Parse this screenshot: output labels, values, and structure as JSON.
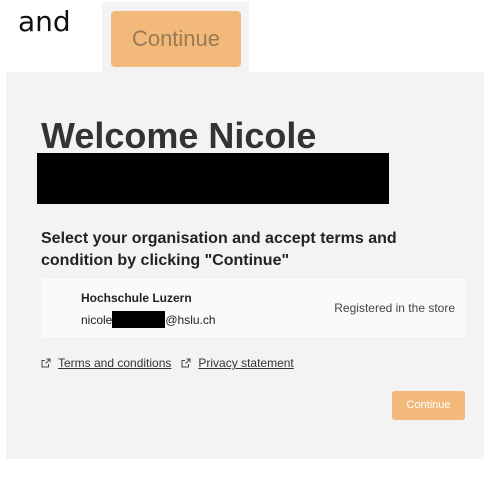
{
  "header": {
    "word": "and",
    "continue_preview_label": "Continue"
  },
  "page": {
    "title": "Welcome Nicole",
    "instruction": "Select your organisation and accept terms and condition by clicking \"Continue\""
  },
  "organisation": {
    "name": "Hochschule Luzern",
    "email_prefix": "nicole",
    "email_suffix": "@hslu.ch",
    "status": "Registered in the store"
  },
  "links": {
    "terms": "Terms and conditions",
    "privacy": "Privacy statement"
  },
  "actions": {
    "continue_label": "Continue"
  },
  "colors": {
    "button_accent": "#f2b97a",
    "card_background": "#f3f3f3",
    "redaction": "#000000"
  },
  "icons": {
    "link_icon": "external-link-icon"
  }
}
